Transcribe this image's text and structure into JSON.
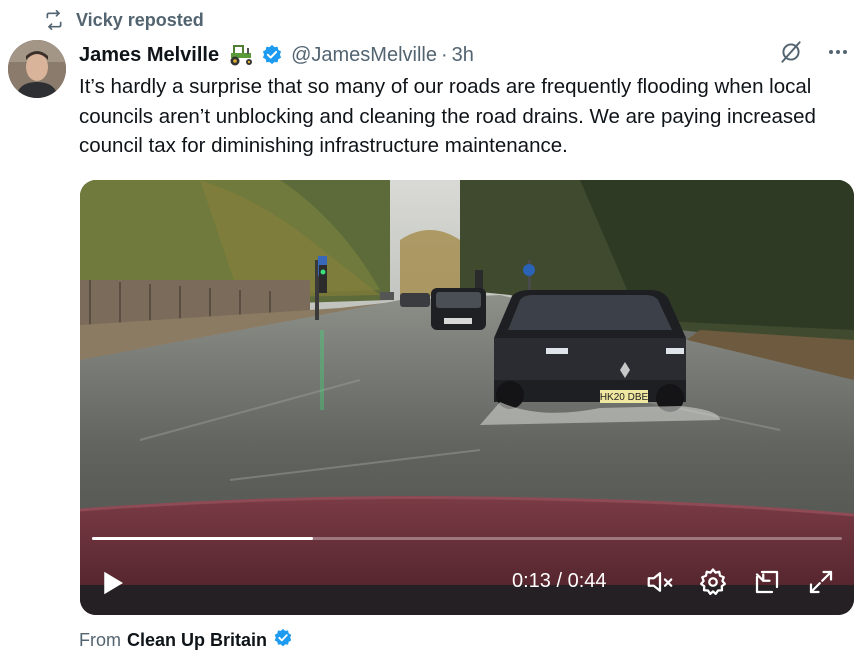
{
  "repost": {
    "text": "Vicky reposted",
    "icon": "repost-icon"
  },
  "author": {
    "name": "James Melville",
    "emoji_icon": "tractor-icon",
    "verified_icon": "verified-badge-icon",
    "handle": "@JamesMelville",
    "separator": "·",
    "time": "3h"
  },
  "tweet": {
    "text": "It’s hardly a surprise that so many of our roads are frequently flooding when local councils aren’t unblocking and cleaning the road drains. We are paying increased council tax for diminishing infrastructure maintenance."
  },
  "video": {
    "current_time": "0:13 / 0:44",
    "progress": 0.295,
    "license_plate": "HK20 DBE",
    "controls": [
      "play-icon",
      "mute-icon",
      "settings-icon",
      "pop-out-icon",
      "fullscreen-icon"
    ]
  },
  "source": {
    "prefix": "From",
    "name": "Clean Up Britain",
    "verified_icon": "verified-badge-icon"
  },
  "colors": {
    "accent": "#1d9bf0",
    "muted": "#536471",
    "text": "#0f1419"
  }
}
